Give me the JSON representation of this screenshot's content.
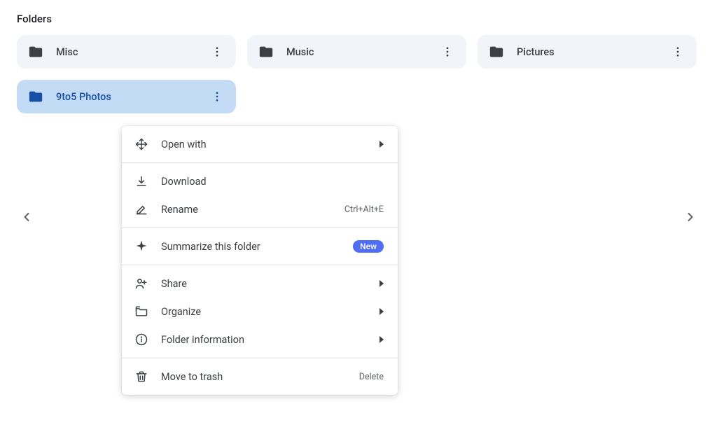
{
  "section_label": "Folders",
  "folders": [
    {
      "name": "Misc"
    },
    {
      "name": "Music"
    },
    {
      "name": "Pictures"
    },
    {
      "name": "9to5 Photos"
    }
  ],
  "context_menu": {
    "open_with": "Open with",
    "download": "Download",
    "rename": "Rename",
    "rename_shortcut": "Ctrl+Alt+E",
    "summarize": "Summarize this folder",
    "summarize_badge": "New",
    "share": "Share",
    "organize": "Organize",
    "folder_info": "Folder information",
    "move_to_trash": "Move to trash",
    "trash_shortcut": "Delete"
  }
}
